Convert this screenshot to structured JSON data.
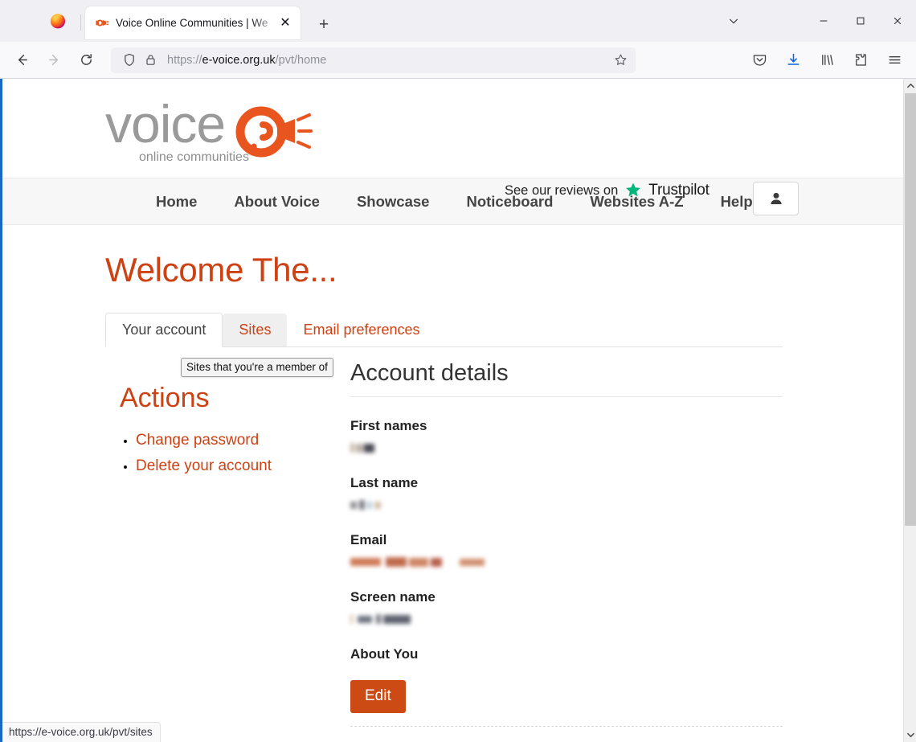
{
  "browser": {
    "app_icon": "firefox-logo-icon",
    "tab": {
      "favicon": "voice-site-favicon",
      "title": "Voice Online Communities | We",
      "close_label": "✕"
    },
    "new_tab_label": "+",
    "window_controls": {
      "list_all_tabs": "⌄",
      "minimize": "—",
      "maximize": "□",
      "close": "✕"
    },
    "toolbar": {
      "back": "back-arrow",
      "forward": "forward-arrow",
      "reload": "reload-arrow",
      "shield": "tracking-protection-shield",
      "lock": "connection-lock",
      "url_scheme": "https://",
      "url_domain": "e-voice.org.uk",
      "url_path": "/pvt/home",
      "bookmark": "star-outline",
      "pocket": "pocket-save",
      "downloads": "download-arrow",
      "library": "library-books",
      "extensions": "extensions-puzzle",
      "menu": "hamburger-menu"
    },
    "status_url": "https://e-voice.org.uk/pvt/sites"
  },
  "site": {
    "logo": {
      "word": "voice",
      "tagline": "online communities"
    },
    "reviews": {
      "prefix": "See our reviews on",
      "brand": "Trustpilot"
    },
    "account_button": "account-person-icon",
    "nav": [
      {
        "label": "Home"
      },
      {
        "label": "About Voice"
      },
      {
        "label": "Showcase"
      },
      {
        "label": "Noticeboard"
      },
      {
        "label": "Websites A-Z"
      },
      {
        "label": "Help"
      }
    ]
  },
  "page": {
    "heading": "Welcome The...",
    "tabs": [
      {
        "label": "Your account",
        "state": "active"
      },
      {
        "label": "Sites",
        "state": "hovered"
      },
      {
        "label": "Email preferences",
        "state": "plain"
      }
    ],
    "tooltip": "Sites that you're a member of",
    "actions": {
      "title": "Actions",
      "items": [
        {
          "label": "Change password"
        },
        {
          "label": "Delete your account"
        }
      ]
    },
    "details": {
      "title": "Account details",
      "fields": [
        {
          "label": "First names",
          "value": "",
          "redacted": true
        },
        {
          "label": "Last name",
          "value": "",
          "redacted": true
        },
        {
          "label": "Email",
          "value": "",
          "redacted": true
        },
        {
          "label": "Screen name",
          "value": "",
          "redacted": true
        },
        {
          "label": "About You",
          "value": "",
          "redacted": false
        }
      ],
      "edit_button": "Edit"
    }
  },
  "colors": {
    "brand_orange": "#ce4112",
    "button_orange": "#cc4b14",
    "logo_gray": "#9a9a9a",
    "trustpilot_green": "#00b67a",
    "nav_bar_bg": "#f7f7f7"
  }
}
